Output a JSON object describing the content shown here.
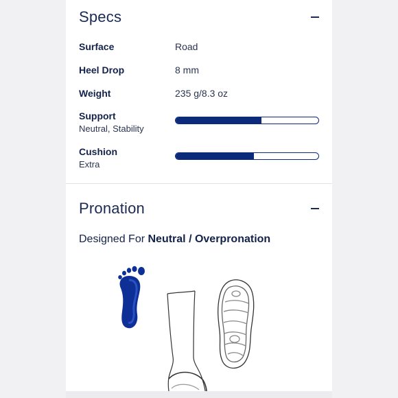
{
  "specs": {
    "title": "Specs",
    "rows": [
      {
        "label": "Surface",
        "value": "Road"
      },
      {
        "label": "Heel Drop",
        "value": "8 mm"
      },
      {
        "label": "Weight",
        "value": "235 g/8.3 oz"
      }
    ],
    "support": {
      "label": "Support",
      "sub": "Neutral, Stability",
      "level": 0.6
    },
    "cushion": {
      "label": "Cushion",
      "sub": "Extra",
      "level": 0.55
    }
  },
  "pronation": {
    "title": "Pronation",
    "designed_prefix": "Designed For ",
    "designed_value": "Neutral / Overpronation"
  },
  "colors": {
    "brand_navy": "#0c2a7a",
    "text_navy": "#13224a",
    "foot_blue": "#0d2f96"
  },
  "icons": [
    "collapse-icon",
    "foot-print-icon",
    "leg-icon",
    "shoe-sole-icon"
  ]
}
